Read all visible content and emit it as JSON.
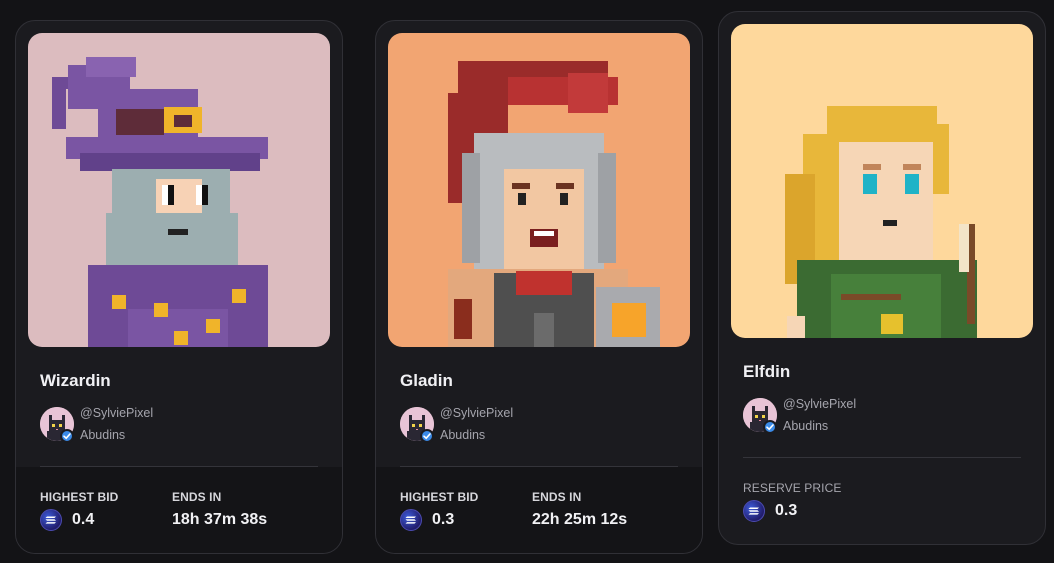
{
  "cards": [
    {
      "name": "Wizardin",
      "bg": "#dcbcbf",
      "creator": {
        "handle": "@SylviePixel",
        "collection": "Abudins"
      },
      "stats": [
        {
          "label": "HIGHEST BID",
          "value": "0.4",
          "currency_icon": "solana-icon"
        },
        {
          "label": "ENDS IN",
          "value": "18h 37m 38s"
        }
      ]
    },
    {
      "name": "Gladin",
      "bg": "#f2a572",
      "creator": {
        "handle": "@SylviePixel",
        "collection": "Abudins"
      },
      "stats": [
        {
          "label": "HIGHEST BID",
          "value": "0.3",
          "currency_icon": "solana-icon"
        },
        {
          "label": "ENDS IN",
          "value": "22h 25m 12s"
        }
      ]
    },
    {
      "name": "Elfdin",
      "bg": "#fed89c",
      "creator": {
        "handle": "@SylviePixel",
        "collection": "Abudins"
      },
      "stats": [
        {
          "label": "RESERVE PRICE",
          "value": "0.3",
          "currency_icon": "solana-icon"
        }
      ]
    }
  ],
  "colors": {
    "page_bg": "#131316",
    "card_bg": "#1b1b1f",
    "verified": "#3b8be8",
    "solana": "#3d5bd8"
  }
}
